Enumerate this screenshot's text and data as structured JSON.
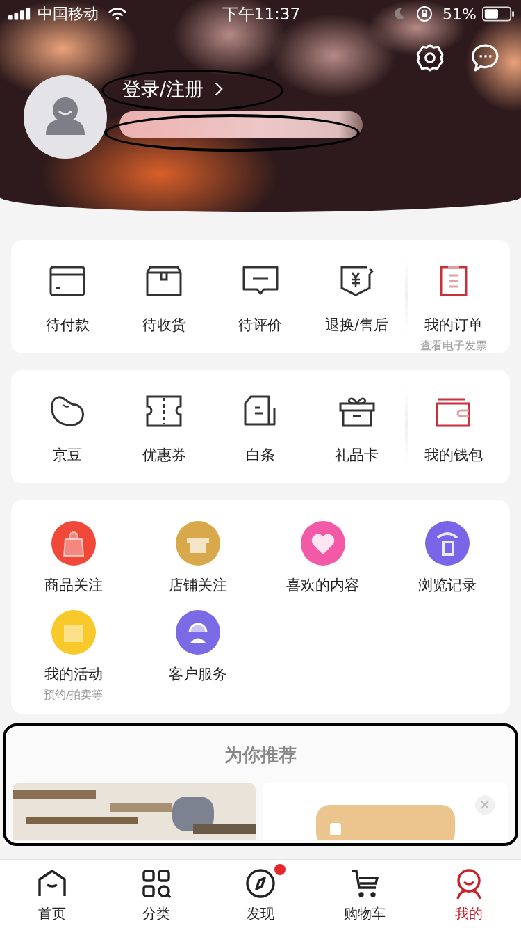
{
  "status_bar": {
    "carrier": "中国移动",
    "time": "下午11:37",
    "battery": "51%"
  },
  "profile": {
    "login": "登录/注册"
  },
  "orders": [
    {
      "kind": "status",
      "label": "待付款"
    },
    {
      "kind": "status",
      "label": "待收货"
    },
    {
      "kind": "status",
      "label": "待评价"
    },
    {
      "kind": "status",
      "label": "退换/售后"
    },
    {
      "kind": "summary",
      "label": "我的订单",
      "sub": "查看电子发票"
    }
  ],
  "assets": [
    {
      "kind": "status",
      "label": "京豆"
    },
    {
      "kind": "status",
      "label": "优惠券"
    },
    {
      "kind": "status",
      "label": "白条"
    },
    {
      "kind": "status",
      "label": "礼品卡"
    },
    {
      "kind": "summary",
      "label": "我的钱包"
    }
  ],
  "services": [
    {
      "label": "商品关注",
      "color": "#f2483a"
    },
    {
      "label": "店铺关注",
      "color": "#d9a84a"
    },
    {
      "label": "喜欢的内容",
      "color": "#f25aa8"
    },
    {
      "label": "浏览记录",
      "color": "#7a64e8"
    },
    {
      "label": "我的活动",
      "sub": "预约/拍卖等",
      "color": "#f7c92a"
    },
    {
      "label": "客户服务",
      "color": "#7b6ae6"
    }
  ],
  "recommend": {
    "title": "为你推荐"
  },
  "tab_bar": [
    {
      "label": "首页",
      "selected": false,
      "dot": false
    },
    {
      "label": "分类",
      "selected": false,
      "dot": false
    },
    {
      "label": "发现",
      "selected": false,
      "dot": true
    },
    {
      "label": "购物车",
      "selected": false,
      "dot": false
    },
    {
      "label": "我的",
      "selected": true,
      "dot": false
    }
  ]
}
